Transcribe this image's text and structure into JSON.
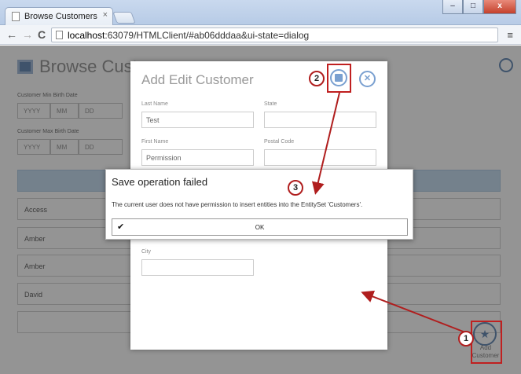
{
  "browser": {
    "tab_title": "Browse Customers",
    "tab_close": "×",
    "url_host": "localhost",
    "url_rest": ":63079/HTMLClient/#ab06dddaa&ui-state=dialog",
    "back_icon": "←",
    "forward_icon": "→",
    "reload_icon": "C",
    "menu_icon": "≡",
    "win_min": "–",
    "win_max": "□",
    "win_close": "x"
  },
  "page": {
    "title": "Browse Customers",
    "min_birth_label": "Customer Min Birth Date",
    "max_birth_label": "Customer Max Birth Date",
    "date_placeholders": [
      "YYYY",
      "MM",
      "DD"
    ],
    "rows": [
      "Access",
      "Amber",
      "Amber",
      "David"
    ],
    "fab_label": "Add Customer",
    "fab_icon": "★"
  },
  "dialog": {
    "title": "Add Edit Customer",
    "close_icon": "✕",
    "fields": {
      "last_name_label": "Last Name",
      "last_name_value": "Test",
      "state_label": "State",
      "state_value": "",
      "first_name_label": "First Name",
      "first_name_value": "Permission",
      "postal_label": "Postal Code",
      "postal_value": "",
      "city_label": "City",
      "city_value": ""
    }
  },
  "message": {
    "title": "Save operation failed",
    "text": "The current user does not have permission to insert entities into the EntitySet 'Customers'.",
    "ok_label": "OK",
    "check_icon": "✔"
  },
  "annotations": {
    "callout_1": "1",
    "callout_2": "2",
    "callout_3": "3",
    "arrow_color": "#b01e1e"
  }
}
